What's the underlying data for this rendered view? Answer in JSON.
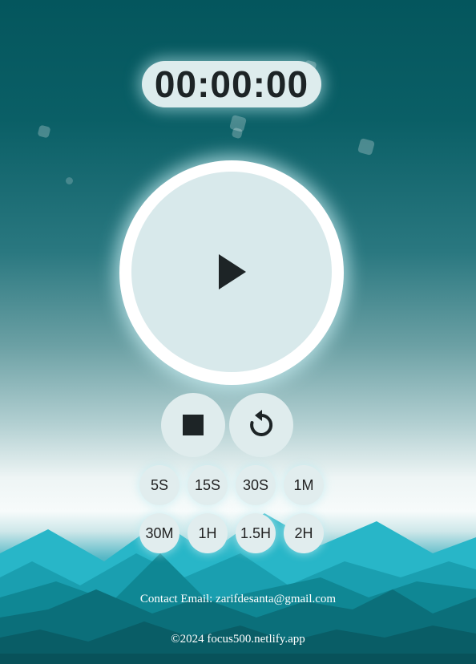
{
  "timer": {
    "display": "00:00:00"
  },
  "controls": {
    "play": {
      "icon": "play-icon"
    },
    "stop": {
      "icon": "stop-icon"
    },
    "reset": {
      "icon": "reset-icon"
    }
  },
  "presets": [
    {
      "label": "5S"
    },
    {
      "label": "15S"
    },
    {
      "label": "30S"
    },
    {
      "label": "1M"
    },
    {
      "label": "30M"
    },
    {
      "label": "1H"
    },
    {
      "label": "1.5H"
    },
    {
      "label": "2H"
    }
  ],
  "footer": {
    "contact": "Contact Email: zarifdesanta@gmail.com",
    "copyright": "©2024 focus500.netlify.app"
  },
  "colors": {
    "background_top": "#04565d",
    "background_mid": "#eef5f5",
    "mountain_light": "#17b4c8",
    "mountain_dark": "#0b5f69",
    "button_fill": "#dfeced",
    "icon": "#1d2426"
  }
}
